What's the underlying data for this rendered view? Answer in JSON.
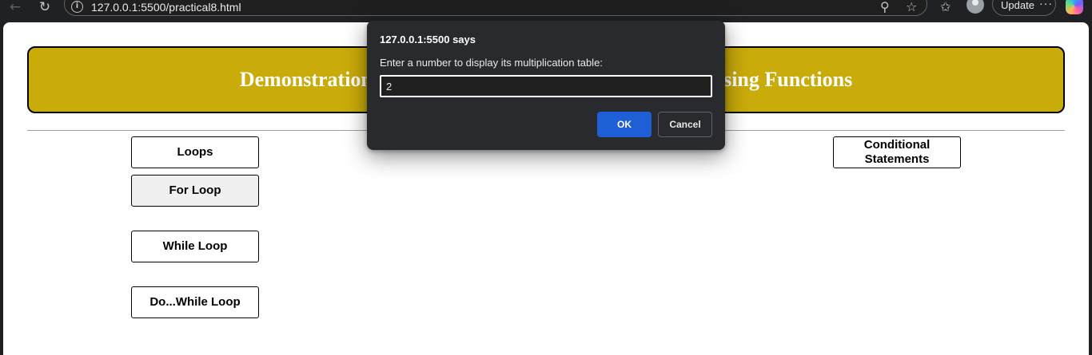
{
  "browser": {
    "url": "127.0.0.1:5500/practical8.html",
    "back_icon": "back-arrow-icon",
    "reload_icon": "reload-icon",
    "update_label": "Update",
    "more_label": "···",
    "nav_back_glyph": "←",
    "nav_reload_glyph": "↻",
    "info_glyph": "i",
    "zoom_glyph": "⚲",
    "favorite_glyph": "☆",
    "favorites_glyph": "✩"
  },
  "page": {
    "header_title": "Demonstration of Loops and Conditional Statements using Functions",
    "buttons": {
      "loops": "Loops",
      "for_loop": "For Loop",
      "while_loop": "While Loop",
      "do_while_loop": "Do...While Loop",
      "conditional_line1": "Conditional",
      "conditional_line2": "Statements"
    },
    "header_color": "#c9ab0a"
  },
  "dialog": {
    "title": "127.0.0.1:5500 says",
    "message": "Enter a number to display its multiplication table:",
    "input_value": "2",
    "ok_label": "OK",
    "cancel_label": "Cancel",
    "ok_color": "#1f5fd6"
  }
}
